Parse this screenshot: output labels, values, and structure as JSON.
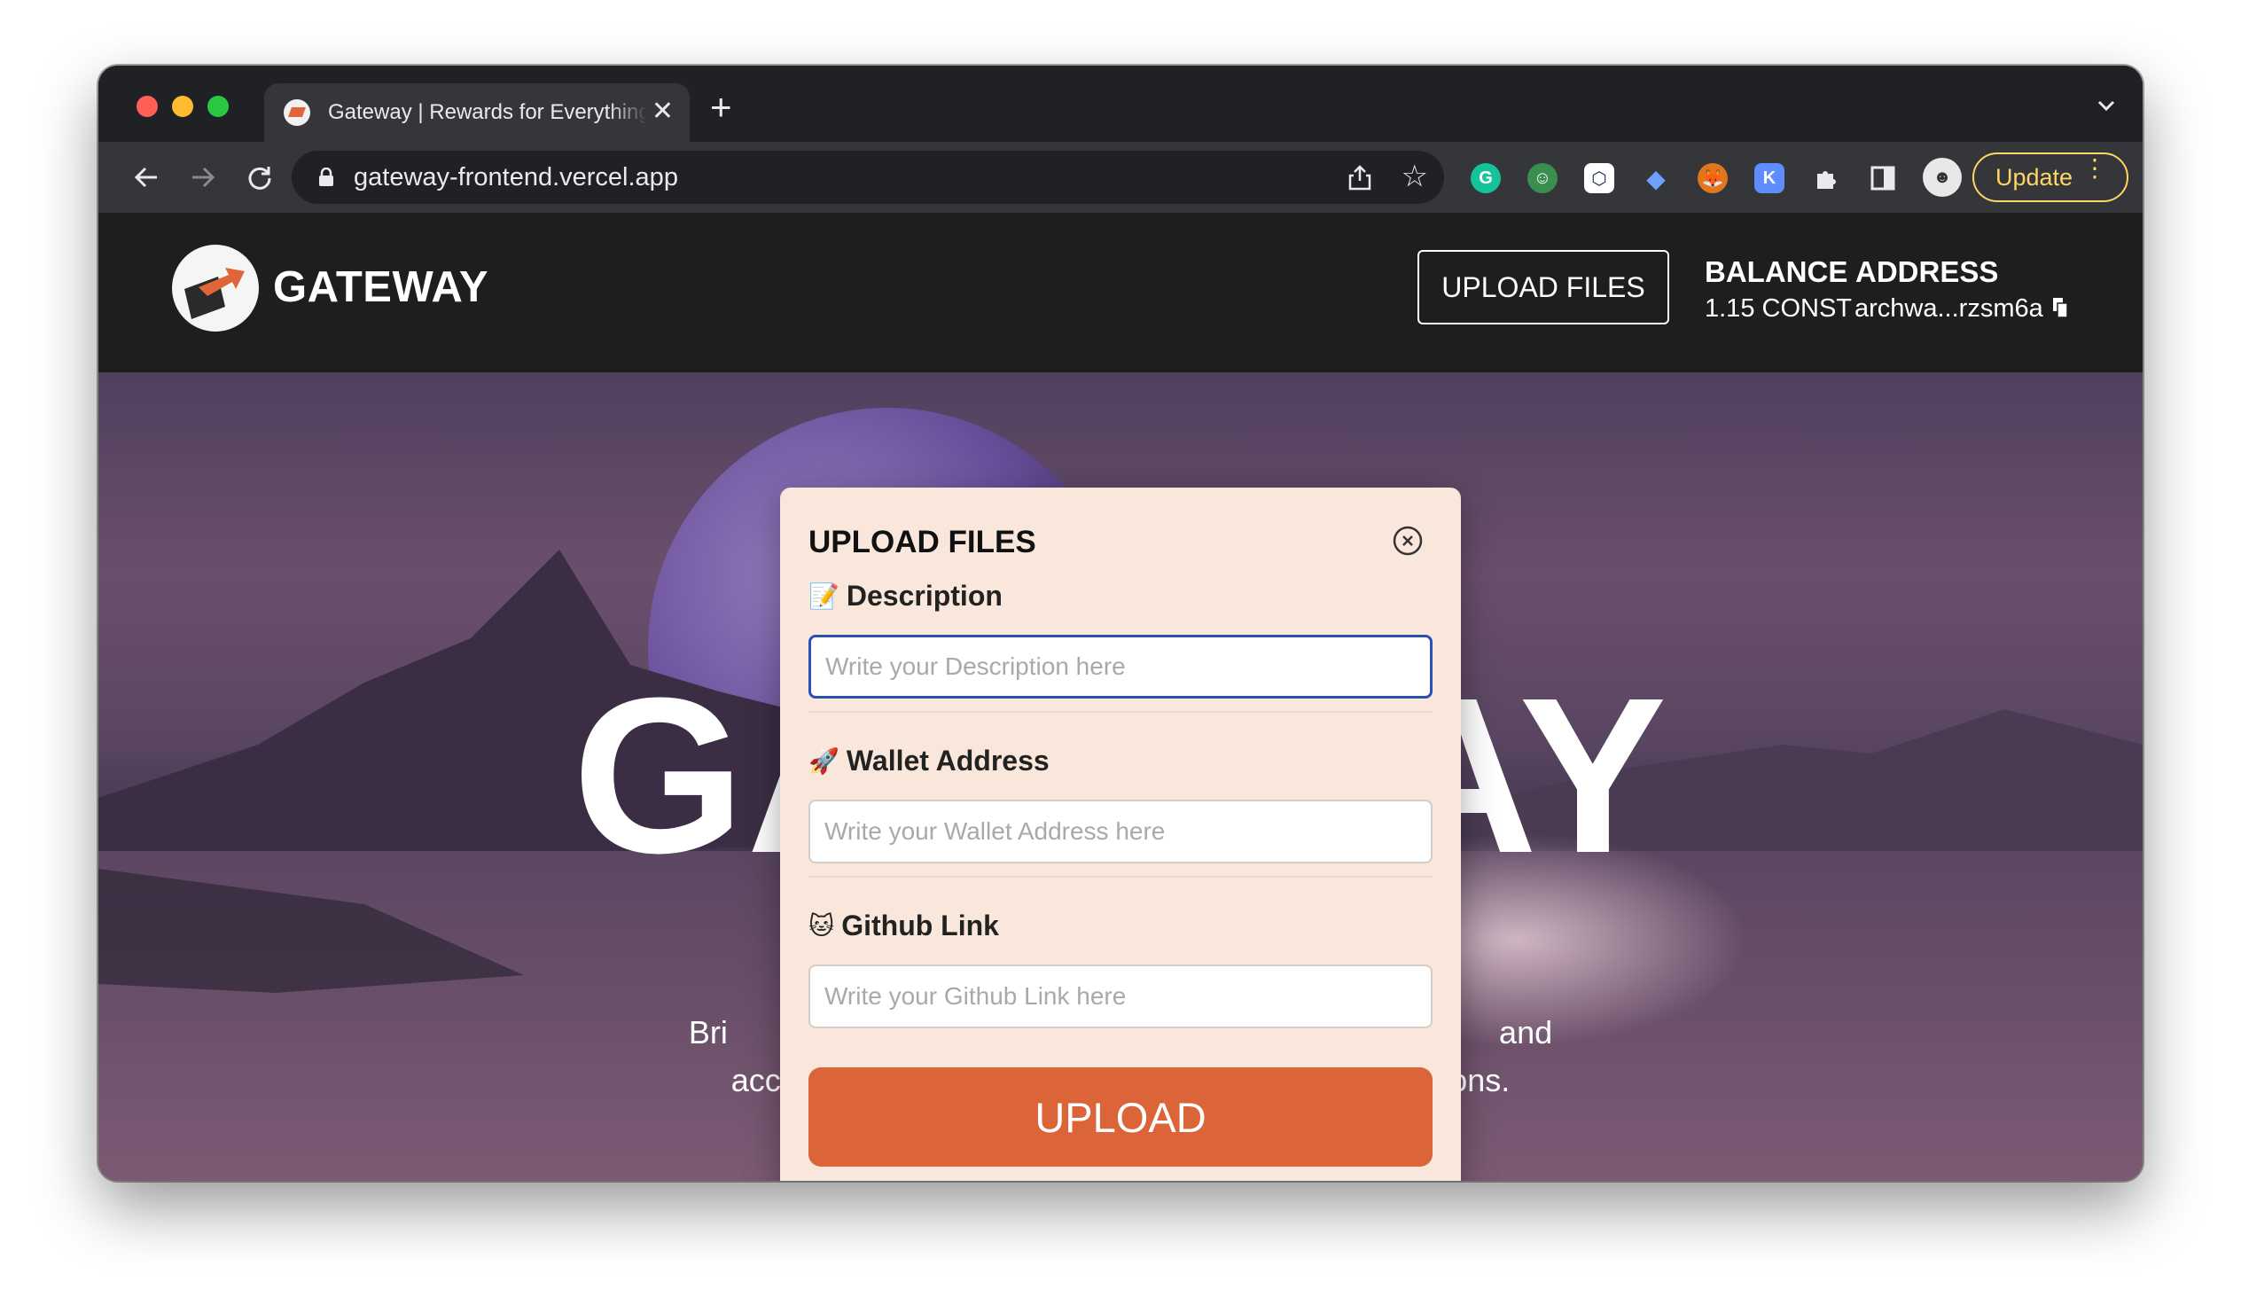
{
  "browser": {
    "tab_title": "Gateway | Rewards for Everything",
    "tab_close": "✕",
    "new_tab": "+",
    "url": "gateway-frontend.vercel.app",
    "update_label": "Update",
    "extensions": [
      "grammarly-icon",
      "robot-extension-icon",
      "hexagon-extension-icon",
      "shield-extension-icon",
      "metamask-icon",
      "keplr-icon",
      "puzzle-extensions-icon",
      "sidepanel-icon",
      "profile-avatar"
    ]
  },
  "site_nav": {
    "brand": "GATEWAY",
    "upload_button": "UPLOAD FILES",
    "balance_label": "BALANCE",
    "balance_value": "1.15 CONST",
    "address_label": "ADDRESS",
    "address_value": "archwa...rzsm6a"
  },
  "hero": {
    "title": "GATEWAY",
    "subtitle_line1": "Bri                                                                                       and",
    "subtitle_line2": "accelerate the growth of the decentralized applications."
  },
  "modal": {
    "title": "UPLOAD FILES",
    "fields": [
      {
        "emoji": "📝",
        "label": "Description",
        "placeholder": "Write your Description here",
        "value": ""
      },
      {
        "emoji": "🚀",
        "label": "Wallet Address",
        "placeholder": "Write your Wallet Address here",
        "value": ""
      },
      {
        "emoji": "🐱",
        "label": "Github Link",
        "placeholder": "Write your Github Link here",
        "value": ""
      }
    ],
    "submit_label": "UPLOAD"
  },
  "colors": {
    "accent": "#dc6439",
    "modal_bg": "#f8e7da",
    "focus_border": "#2a4fb8",
    "update_yellow": "#fdd663"
  }
}
